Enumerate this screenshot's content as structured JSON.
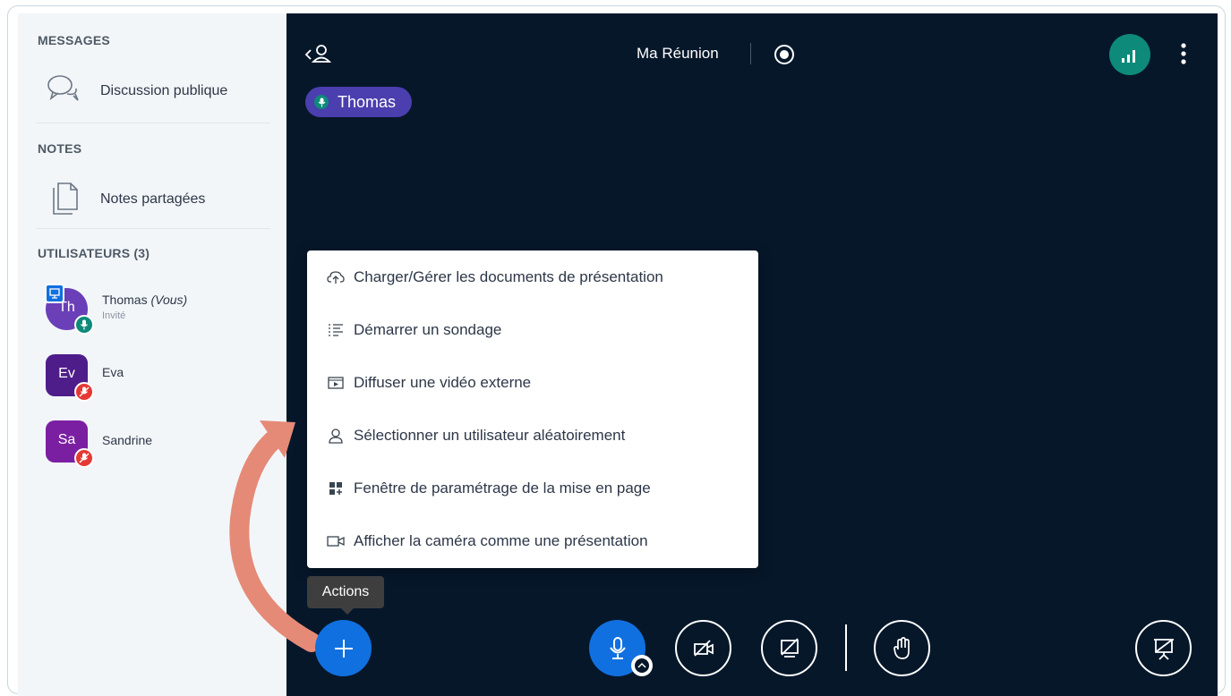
{
  "sidebar": {
    "messages_header": "MESSAGES",
    "public_chat_label": "Discussion publique",
    "notes_header": "NOTES",
    "shared_notes_label": "Notes partagées",
    "users_header": "UTILISATEURS (3)",
    "users": [
      {
        "initials": "Th",
        "name": "Thomas",
        "you_tag": "(Vous)",
        "role": "Invité",
        "avatar_color": "#6a3fb8",
        "audio": "unmuted"
      },
      {
        "initials": "Ev",
        "name": "Eva",
        "avatar_color": "#4e1d8a",
        "audio": "muted"
      },
      {
        "initials": "Sa",
        "name": "Sandrine",
        "avatar_color": "#7b1fa2",
        "audio": "muted"
      }
    ]
  },
  "main": {
    "meeting_title": "Ma Réunion",
    "talking_indicator": "Thomas",
    "tooltip": "Actions",
    "actions_menu": [
      {
        "icon": "cloud-upload-icon",
        "label": "Charger/Gérer les documents de présentation"
      },
      {
        "icon": "poll-list-icon",
        "label": "Démarrer un sondage"
      },
      {
        "icon": "external-video-icon",
        "label": "Diffuser une vidéo externe"
      },
      {
        "icon": "user-icon",
        "label": "Sélectionner un utilisateur aléatoirement"
      },
      {
        "icon": "layout-grid-icon",
        "label": "Fenêtre de paramétrage de la mise en page"
      },
      {
        "icon": "camera-icon",
        "label": "Afficher la caméra comme une présentation"
      }
    ]
  },
  "colors": {
    "main_bg": "#06172a",
    "accent_blue": "#1170e0",
    "talker_purple": "#4b3eae",
    "connection_green": "#0d8a7a",
    "muted_red": "#e53935",
    "arrow": "#e58a77"
  }
}
